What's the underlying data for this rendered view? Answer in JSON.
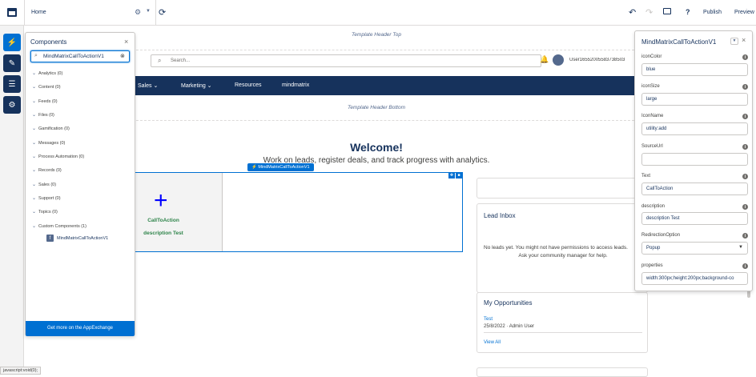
{
  "topbar": {
    "page_select": "Home",
    "undo_icon": "undo-icon",
    "redo_icon": "redo-icon",
    "preview_device_icon": "desktop-icon",
    "help": "?",
    "publish": "Publish",
    "preview": "Preview"
  },
  "components_panel": {
    "title": "Components",
    "search_value": "MindMatrixCallToActionV1",
    "categories": [
      "Analytics (0)",
      "Content (0)",
      "Feeds (0)",
      "Files (0)",
      "Gamification (0)",
      "Messages (0)",
      "Process Automation (0)",
      "Records (0)",
      "Sales (0)",
      "Support (0)",
      "Topics (0)",
      "Custom Components (1)"
    ],
    "custom_item": "MindMatrixCallToActionV1",
    "appexchange": "Get more on the AppExchange"
  },
  "canvas": {
    "template_header_top": "Template Header Top",
    "search_placeholder": "Search...",
    "username": "User16552005583738503",
    "nav": [
      "Sales",
      "Marketing",
      "Resources",
      "mindmatrix"
    ],
    "template_header_bottom": "Template Header Bottom",
    "welcome_title": "Welcome!",
    "welcome_sub": "Work on leads, register deals, and track progress with analytics.",
    "component_tag": "MindMatrixCallToActionV1",
    "cta_label": "CallToAction",
    "cta_description": "description Test",
    "lead_inbox": {
      "title": "Lead Inbox",
      "message_1": "No leads yet. You might not have permissions to access leads.",
      "message_2": "Ask your community manager for help."
    },
    "opportunities": {
      "title": "My Opportunities",
      "link": "Test",
      "meta": "25/8/2022 · Admin User",
      "view_all": "View All"
    }
  },
  "properties_panel": {
    "title": "MindMatrixCallToActionV1",
    "fields": [
      {
        "label": "iconColor",
        "value": "blue"
      },
      {
        "label": "iconSize",
        "value": "large"
      },
      {
        "label": "IconName",
        "value": "utility:add"
      },
      {
        "label": "SourceUrl",
        "value": ""
      },
      {
        "label": "Text",
        "value": "CallToAction"
      },
      {
        "label": "description",
        "value": "description Test"
      },
      {
        "label": "RedirectionOption",
        "value": "Popup"
      },
      {
        "label": "properties",
        "value": "width:300px;height:200px;background-co"
      }
    ]
  },
  "status_bar": "javascript:void(0);",
  "colors": {
    "nav_bg": "#16325c",
    "brand_blue": "#0070d2",
    "cta_green": "#2e844a",
    "cta_plus": "#0000ff"
  }
}
